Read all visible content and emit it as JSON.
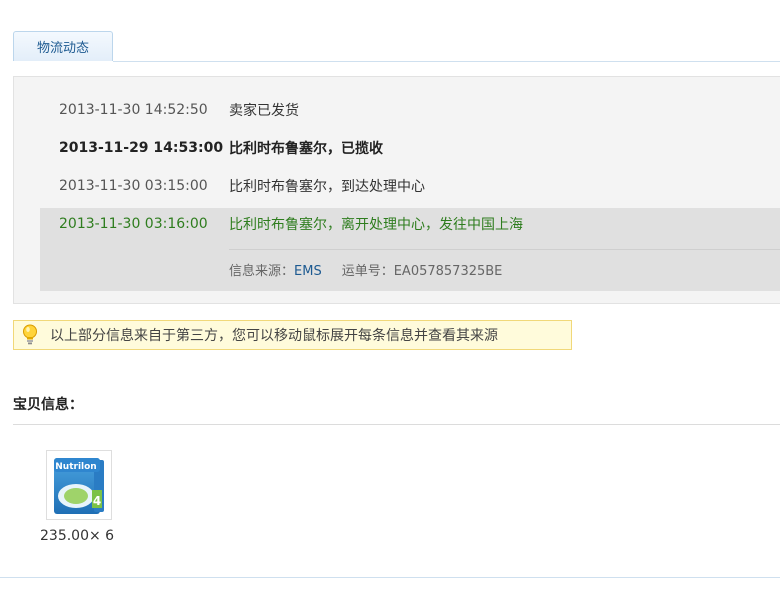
{
  "tab": {
    "label": "物流动态"
  },
  "tracking": {
    "entries": [
      {
        "time": "2013-11-30 14:52:50",
        "desc": "卖家已发货"
      },
      {
        "time": "2013-11-29 14:53:00",
        "desc": "比利时布鲁塞尔，已揽收"
      },
      {
        "time": "2013-11-30 03:15:00",
        "desc": "比利时布鲁塞尔，到达处理中心"
      },
      {
        "time": "2013-11-30 03:16:00",
        "desc": "比利时布鲁塞尔，离开处理中心，发往中国上海"
      }
    ],
    "source_label": "信息来源：",
    "source_value": "EMS",
    "tracking_label": "运单号：",
    "tracking_value": "EA057857325BE"
  },
  "notice": {
    "text": "以上部分信息来自于第三方，您可以移动鼠标展开每条信息并查看其来源",
    "icon": "lightbulb-icon"
  },
  "product_section": {
    "title": "宝贝信息：",
    "item": {
      "brand": "Nutrilon",
      "stage": "4",
      "price_text": "235.00× 6"
    }
  },
  "colors": {
    "accent": "#1d5a91",
    "highlight_text": "#2e7d1e",
    "notice_bg": "#fffbdb"
  }
}
